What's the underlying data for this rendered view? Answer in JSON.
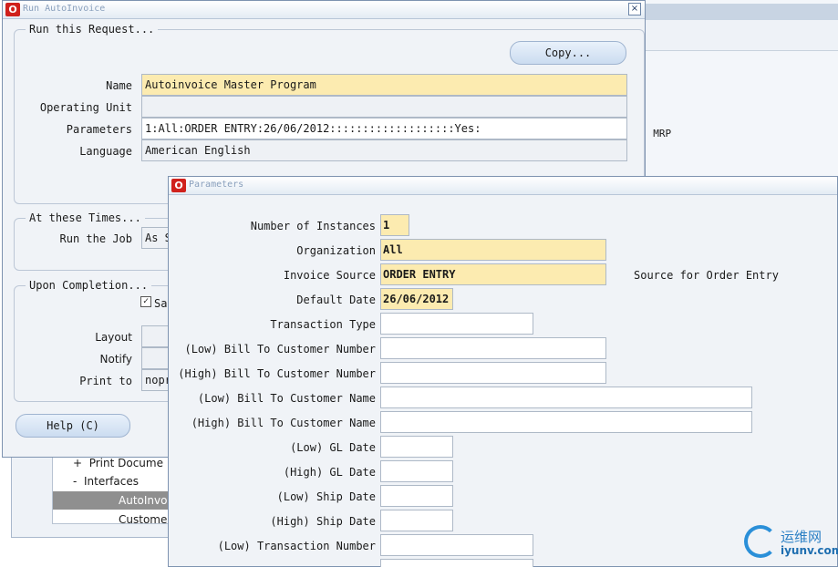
{
  "background_window": {
    "mrp_text": "- MRP"
  },
  "navigator": {
    "items": [
      {
        "prefix": "+",
        "label": "Print Docume"
      },
      {
        "prefix": "-",
        "label": "Interfaces"
      },
      {
        "prefix": "",
        "label": "AutoInvo"
      },
      {
        "prefix": "",
        "label": "Customer"
      }
    ]
  },
  "run_window": {
    "title": "Run AutoInvoice",
    "close_glyph": "×",
    "group_request": "Run this Request...",
    "copy_button": "Copy...",
    "name_label": "Name",
    "name_value": "Autoinvoice Master Program",
    "operating_unit_label": "Operating Unit",
    "operating_unit_value": "",
    "parameters_label": "Parameters",
    "parameters_value": "1:All:ORDER ENTRY:26/06/2012:::::::::::::::::::Yes:",
    "language_label": "Language",
    "language_value": "American English",
    "group_times": "At these Times...",
    "run_job_label": "Run the Job",
    "run_job_value": "As S",
    "group_completion": "Upon Completion...",
    "save_checkbox_label": "Sa",
    "layout_label": "Layout",
    "notify_label": "Notify",
    "print_to_label": "Print to",
    "print_to_value": "nopr",
    "help_button": "Help (C)"
  },
  "parameters_window": {
    "title": "Parameters",
    "fields": [
      {
        "label": "Number of Instances",
        "value": "1",
        "required": true
      },
      {
        "label": "Organization",
        "value": "All",
        "required": true
      },
      {
        "label": "Invoice Source",
        "value": "ORDER ENTRY",
        "required": true
      },
      {
        "label": "Default Date",
        "value": "26/06/2012",
        "required": true
      },
      {
        "label": "Transaction Type",
        "value": "",
        "required": false
      },
      {
        "label": "(Low) Bill To Customer Number",
        "value": "",
        "required": false
      },
      {
        "label": "(High) Bill To Customer Number",
        "value": "",
        "required": false
      },
      {
        "label": "(Low) Bill To Customer Name",
        "value": "",
        "required": false
      },
      {
        "label": "(High) Bill To Customer Name",
        "value": "",
        "required": false
      },
      {
        "label": "(Low) GL Date",
        "value": "",
        "required": false
      },
      {
        "label": "(High) GL Date",
        "value": "",
        "required": false
      },
      {
        "label": "(Low) Ship Date",
        "value": "",
        "required": false
      },
      {
        "label": "(High) Ship Date",
        "value": "",
        "required": false
      },
      {
        "label": "(Low) Transaction Number",
        "value": "",
        "required": false
      }
    ],
    "source_description": "Source for Order Entry"
  },
  "watermark": {
    "cn": "运维网",
    "en": "iyunv.com"
  }
}
